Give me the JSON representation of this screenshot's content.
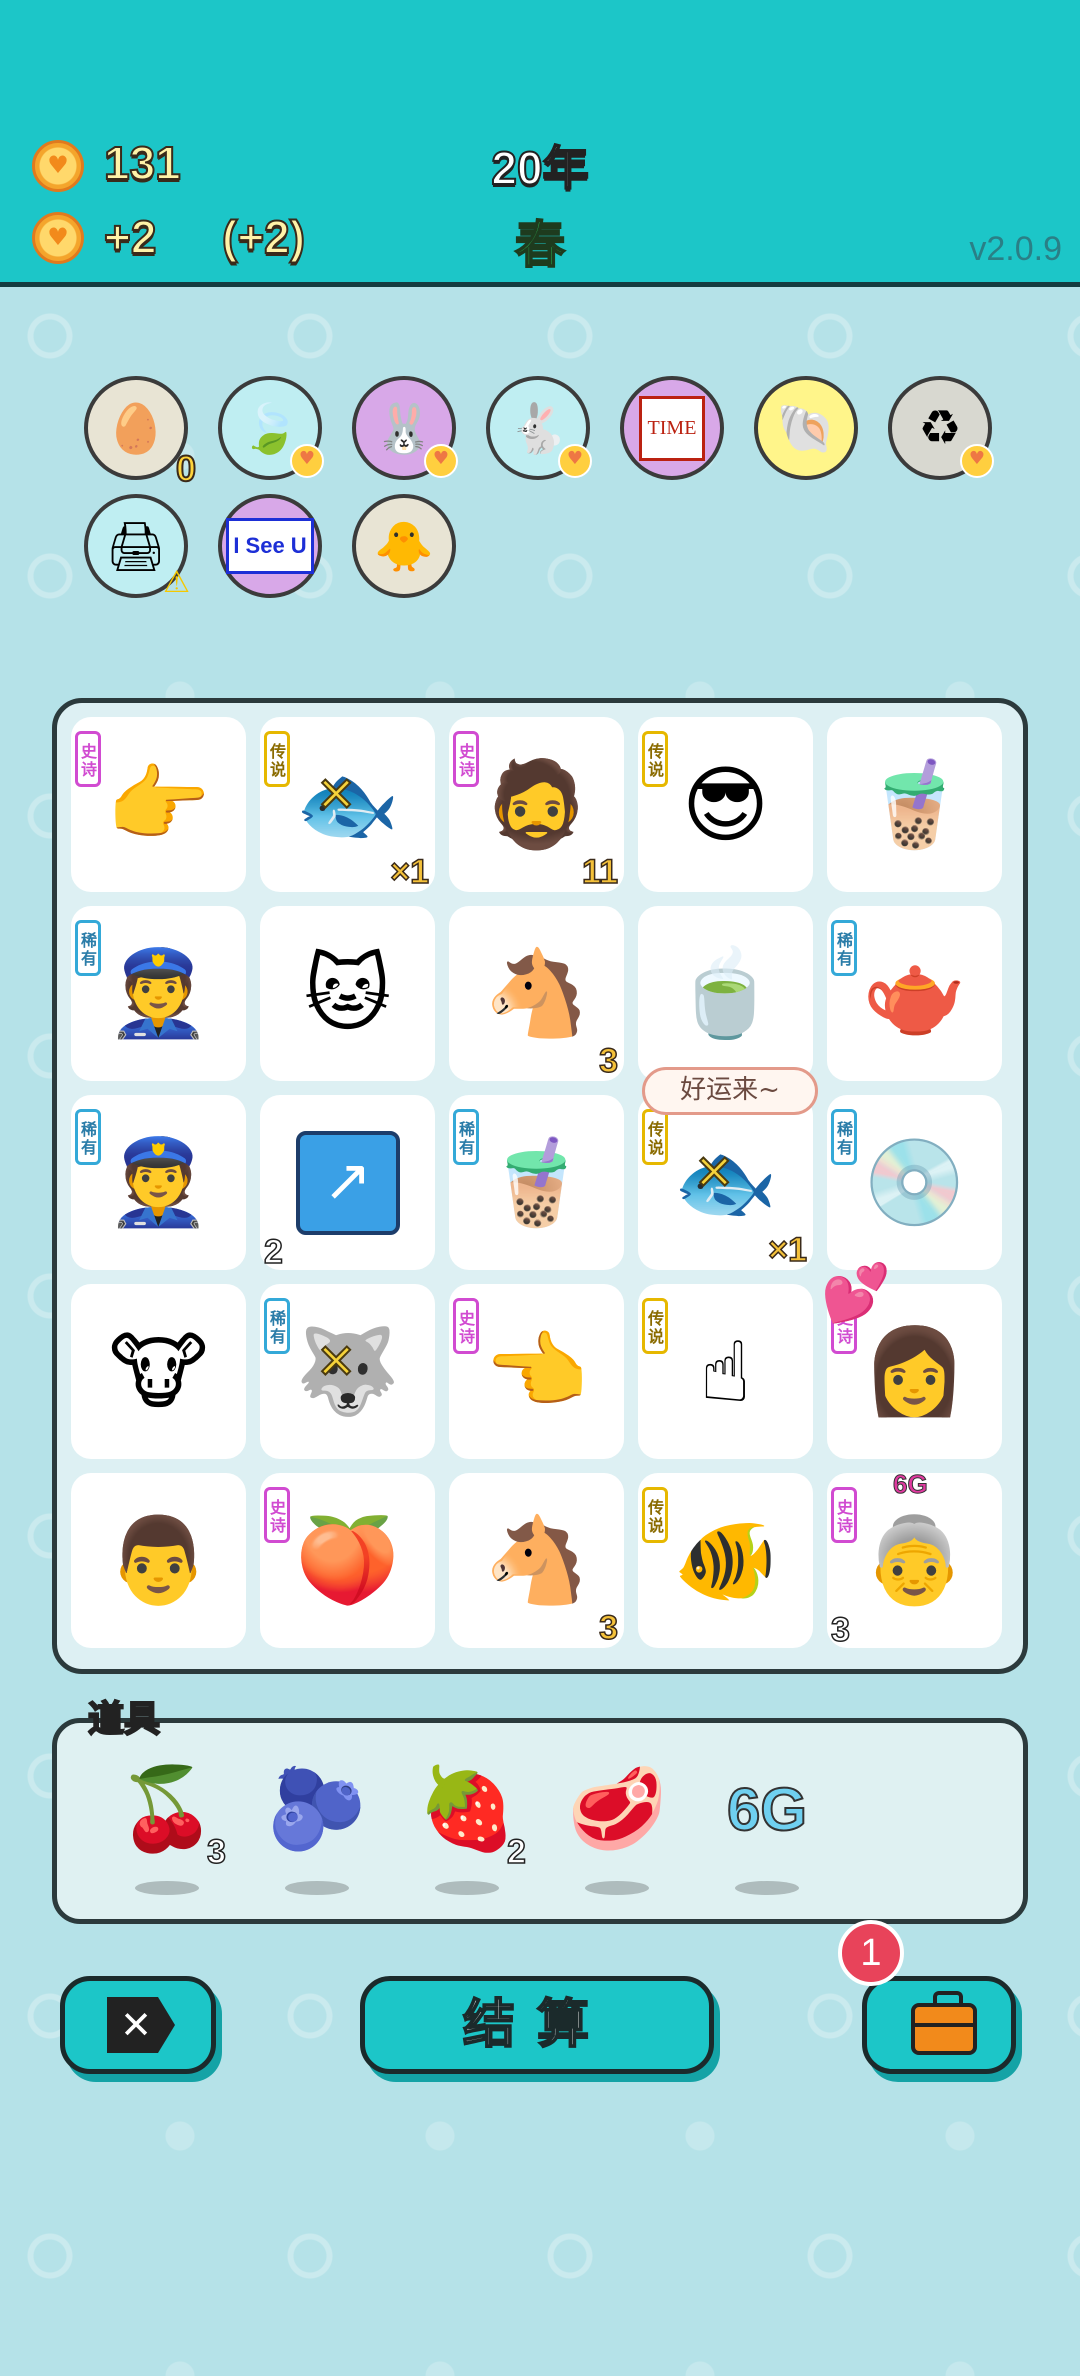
{
  "header": {
    "coins": "131",
    "income": "+2",
    "income_bonus": "(+2)",
    "year": "20年",
    "season": "春",
    "version": "v2.0.9"
  },
  "relics": [
    {
      "name": "egg-tray-relic",
      "count": "0"
    },
    {
      "name": "leaf-relic"
    },
    {
      "name": "pink-rabbit-relic"
    },
    {
      "name": "white-rabbit-relic"
    },
    {
      "name": "time-magazine-relic",
      "text": "TIME"
    },
    {
      "name": "seashell-relic"
    },
    {
      "name": "recycle-relic"
    },
    {
      "name": "printer-relic"
    },
    {
      "name": "i-see-u-relic",
      "text": "I See U"
    },
    {
      "name": "chick-egg-relic"
    }
  ],
  "tags": {
    "epic": "史诗",
    "legend": "传说",
    "rare": "稀有"
  },
  "board": {
    "bubble": "好运来~",
    "cells": [
      {
        "icon": "pointing-hand-icon",
        "tag": "epic",
        "glyph": "👉"
      },
      {
        "icon": "koi-fish-icon",
        "tag": "legend",
        "glyph": "🐟",
        "count": "×1",
        "crossed": true
      },
      {
        "icon": "green-hat-man-icon",
        "tag": "epic",
        "glyph": "🧔",
        "count": "11"
      },
      {
        "icon": "sunglasses-man-icon",
        "tag": "legend",
        "glyph": "😎"
      },
      {
        "icon": "milk-tea-cup-icon",
        "glyph": "🧋"
      },
      {
        "icon": "police-officer-icon",
        "tag": "rare",
        "glyph": "👮"
      },
      {
        "icon": "cat-icon",
        "glyph": "🐱"
      },
      {
        "icon": "horse-icon",
        "glyph": "🐴",
        "count": "3"
      },
      {
        "icon": "tea-bowl-icon",
        "glyph": "🍵"
      },
      {
        "icon": "teapot-icon",
        "tag": "rare",
        "glyph": "🫖"
      },
      {
        "icon": "police-officer-icon",
        "tag": "rare",
        "glyph": "👮"
      },
      {
        "icon": "chart-icon",
        "glyph": "📈",
        "count_left": "2"
      },
      {
        "icon": "milk-tea-cup-icon",
        "tag": "rare",
        "glyph": "🧋"
      },
      {
        "icon": "koi-fish-icon",
        "tag": "legend",
        "glyph": "🐟",
        "count": "×1",
        "crossed": true
      },
      {
        "icon": "cd-disc-icon",
        "tag": "rare",
        "glyph": "💿"
      },
      {
        "icon": "cow-icon",
        "glyph": "🐮"
      },
      {
        "icon": "husky-dog-icon",
        "tag": "rare",
        "glyph": "🐺",
        "crossed": true
      },
      {
        "icon": "pointing-hand-icon",
        "tag": "epic",
        "glyph": "👈"
      },
      {
        "icon": "finger-up-icon",
        "tag": "legend",
        "glyph": "☝"
      },
      {
        "icon": "girl-icon",
        "tag": "epic",
        "glyph": "👩",
        "hearts": true
      },
      {
        "icon": "man-face-icon",
        "glyph": "👨"
      },
      {
        "icon": "peach-icon",
        "tag": "epic",
        "glyph": "🍑"
      },
      {
        "icon": "horse-icon",
        "glyph": "🐴",
        "count": "3"
      },
      {
        "icon": "koi-fish-icon",
        "tag": "legend",
        "glyph": "🐠"
      },
      {
        "icon": "grandma-icon",
        "tag": "epic",
        "glyph": "👵",
        "count_left": "3",
        "label": "6G"
      }
    ]
  },
  "items": {
    "title": "道具",
    "list": [
      {
        "icon": "bayberry-icon",
        "glyph": "🍒",
        "count": "3"
      },
      {
        "icon": "blueberry-icon",
        "glyph": "🫐"
      },
      {
        "icon": "strawberry-icon",
        "glyph": "🍓",
        "count": "2"
      },
      {
        "icon": "liver-icon",
        "glyph": "🥩"
      },
      {
        "icon": "6g-icon",
        "text": "6G"
      }
    ]
  },
  "buttons": {
    "settle": "结算",
    "bag_badge": "1"
  }
}
